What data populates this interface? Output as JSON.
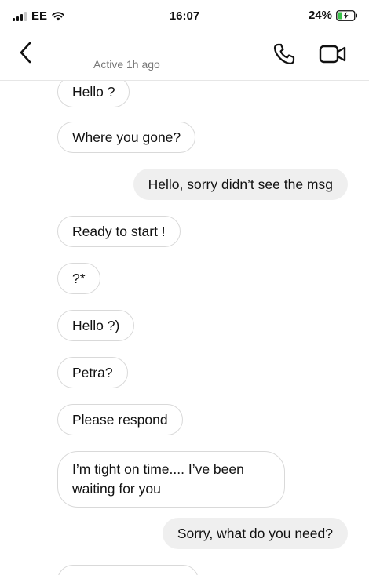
{
  "status_bar": {
    "carrier": "EE",
    "time": "16:07",
    "battery": "24%"
  },
  "header": {
    "status": "Active 1h ago"
  },
  "icons": {
    "back": "chevron-left-icon",
    "call": "phone-icon",
    "video": "video-camera-icon"
  },
  "messages": [
    {
      "direction": "in",
      "text": "Hello ?"
    },
    {
      "direction": "in",
      "text": "Where you gone?"
    },
    {
      "direction": "out",
      "text": "Hello, sorry didn’t see the msg"
    },
    {
      "direction": "in",
      "text": "Ready to start !"
    },
    {
      "direction": "in",
      "text": "?*"
    },
    {
      "direction": "in",
      "text": "Hello ?)"
    },
    {
      "direction": "in",
      "text": "Petra?"
    },
    {
      "direction": "in",
      "text": "Please respond"
    },
    {
      "direction": "in",
      "text": "I’m tight on time.... I’ve been waiting for you"
    },
    {
      "direction": "out",
      "text": "Sorry, what do you need?"
    }
  ]
}
